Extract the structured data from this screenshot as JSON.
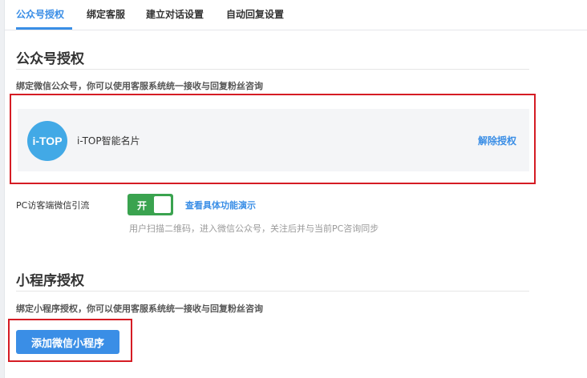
{
  "tabs": [
    {
      "label": "公众号授权",
      "active": true
    },
    {
      "label": "绑定客服",
      "active": false
    },
    {
      "label": "建立对话设置",
      "active": false
    },
    {
      "label": "自动回复设置",
      "active": false
    }
  ],
  "official_account": {
    "title": "公众号授权",
    "description": "绑定微信公众号，你可以使用客服系统统一接收与回复粉丝咨询",
    "account": {
      "logo_text": "i-TOP",
      "name": "i-TOP智能名片",
      "unbind_label": "解除授权"
    },
    "pc_redirect": {
      "label": "PC访客端微信引流",
      "toggle_label": "开",
      "toggle_on": true,
      "demo_link": "查看具体功能演示",
      "hint": "用户扫描二维码，进入微信公众号，关注后并与当前PC咨询同步"
    }
  },
  "mini_program": {
    "title": "小程序授权",
    "description": "绑定小程序授权，你可以使用客服系统统一接收与回复粉丝咨询",
    "add_button": "添加微信小程序"
  },
  "colors": {
    "accent": "#3a8ee6",
    "toggle_on": "#3aa34f",
    "annotation_red": "#d51c24",
    "logo_blue": "#42a9e6"
  }
}
